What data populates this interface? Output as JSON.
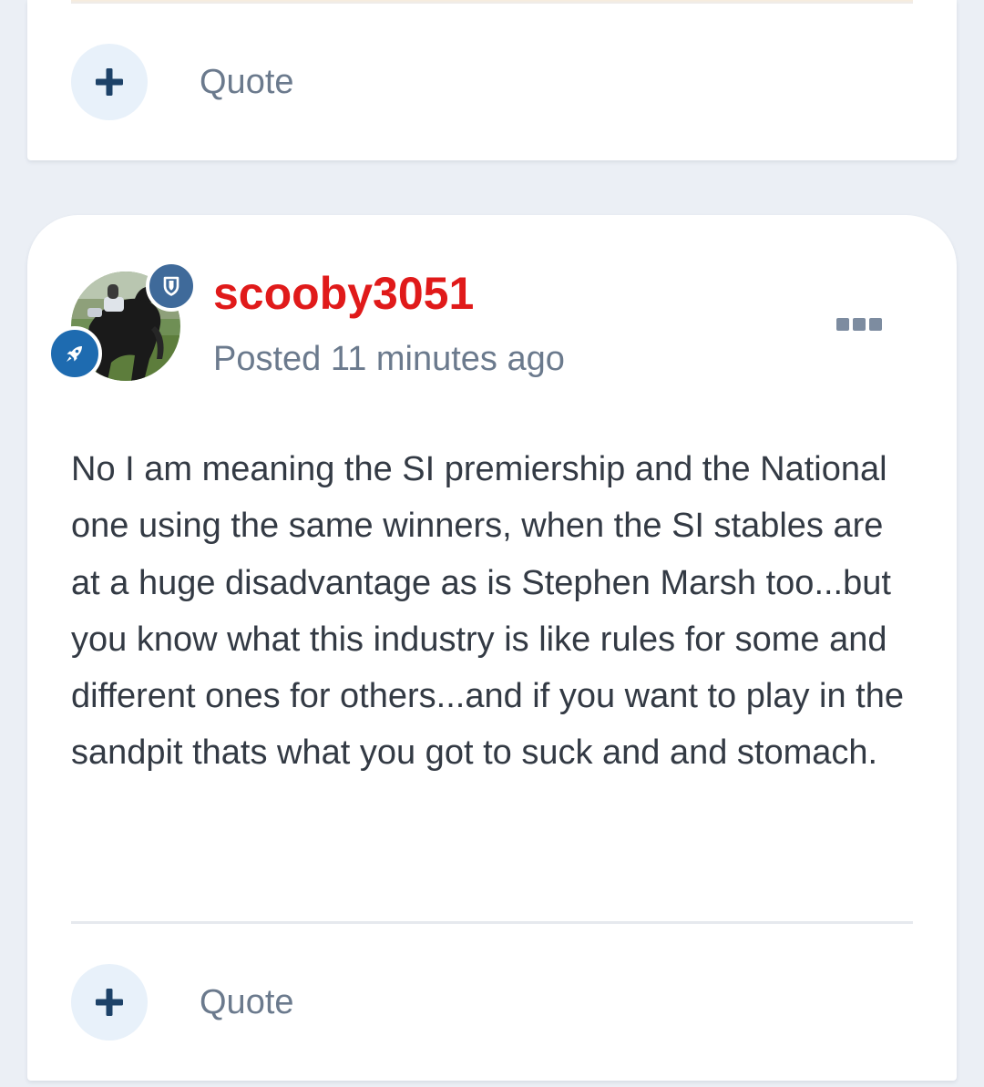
{
  "top_post": {
    "quote_label": "Quote"
  },
  "post": {
    "author": "scooby3051",
    "posted_prefix": "Posted ",
    "posted_time": "11 minutes ago",
    "body": "No I am meaning the SI premiership and the National one using the same winners, when the SI stables are at a huge disadvantage as is Stephen Marsh too...but you know what this industry is like rules for some and different ones for others...and if you want to play in the sandpit thats what you got to suck and and stomach.",
    "quote_label": "Quote"
  },
  "icons": {
    "plus": "plus-icon",
    "shield": "shield-icon",
    "rocket": "rocket-icon",
    "more": "ellipsis-menu-icon"
  },
  "colors": {
    "author": "#e01a1a",
    "plus_icon": "#1d4268",
    "plus_bg": "#e8f1fa",
    "page_bg": "#ebeff5",
    "muted_text": "#6b7a8d"
  }
}
